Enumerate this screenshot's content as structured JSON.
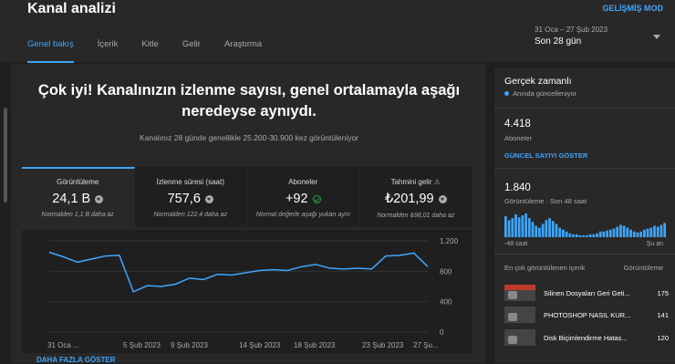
{
  "header": {
    "title": "Kanal analizi",
    "advanced_mode": "GELİŞMİŞ MOD",
    "tabs": [
      "Genel bakış",
      "İçerik",
      "Kitle",
      "Gelir",
      "Araştırma"
    ],
    "date_range": "31 Oca – 27 Şub 2023",
    "period": "Son 28 gün"
  },
  "overview": {
    "headline": "Çok iyi! Kanalınızın izlenme sayısı, genel ortalamayla aşağı neredeyse aynıydı.",
    "subtext": "Kanalınız 28 günde genellikle 25.200-30.900 kez görüntüleniyor",
    "metrics": [
      {
        "label": "Görüntüleme",
        "value": "24,1 B",
        "note": "Normalden 1,1 B daha az"
      },
      {
        "label": "İzlenme süresi (saat)",
        "value": "757,6",
        "note": "Normalden 122,4 daha az"
      },
      {
        "label": "Aboneler",
        "value": "+92",
        "note": "Normal değerle aşağı yukarı aynı"
      },
      {
        "label": "Tahmini gelir",
        "value": "₺201,99",
        "note": "Normalden ₺98,01 daha az",
        "warn": "⚠"
      }
    ],
    "more_link": "DAHA FAZLA GÖSTER"
  },
  "chart_data": {
    "type": "line",
    "x_tick_labels": [
      "31 Oca ...",
      "5 Şub 2023",
      "9 Şub 2023",
      "14 Şub 2023",
      "18 Şub 2023",
      "23 Şub 2023",
      "27 Şu..."
    ],
    "y_tick_labels": [
      "1.200",
      "800",
      "400",
      "0"
    ],
    "ylim": [
      0,
      1200
    ],
    "values": [
      1050,
      990,
      920,
      960,
      1000,
      1010,
      530,
      610,
      600,
      630,
      710,
      690,
      760,
      750,
      780,
      810,
      820,
      810,
      860,
      890,
      840,
      830,
      840,
      830,
      1000,
      1010,
      1040,
      860
    ],
    "line_color": "#3ea6ff"
  },
  "realtime": {
    "title": "Gerçek zamanlı",
    "live_note": "Anında güncelleniyor",
    "subscribers": "4.418",
    "subscribers_label": "Aboneler",
    "show_button": "GÜNCEL SAYIYI GÖSTER",
    "views": "1.840",
    "views_label": "Görüntüleme · Son 48 saat",
    "axis_start": "-48 saat",
    "axis_end": "Şu an",
    "bars": [
      22,
      18,
      20,
      24,
      21,
      23,
      25,
      20,
      16,
      12,
      10,
      14,
      18,
      20,
      17,
      14,
      10,
      8,
      6,
      4,
      3,
      3,
      2,
      2,
      2,
      3,
      3,
      4,
      6,
      6,
      7,
      8,
      9,
      11,
      13,
      12,
      10,
      8,
      6,
      5,
      6,
      8,
      9,
      10,
      12,
      11,
      13,
      15
    ],
    "top_content_label": "En çok görüntülenen içerik",
    "top_content_col": "Görüntüleme",
    "top_content": [
      {
        "title": "Silinen Dosyaları Geri Geti...",
        "views": "175"
      },
      {
        "title": "PHOTOSHOP NASIL KUR...",
        "views": "141"
      },
      {
        "title": "Disk Biçimlendirme Hatas...",
        "views": "120"
      }
    ]
  }
}
